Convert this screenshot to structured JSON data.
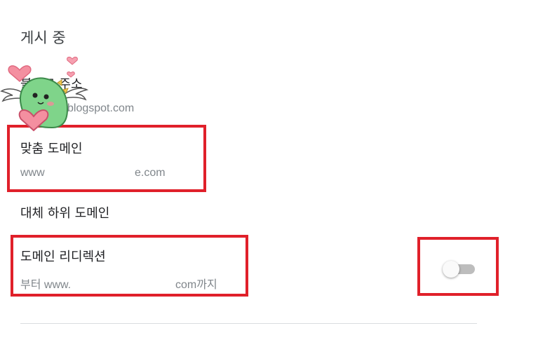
{
  "section": {
    "title": "게시 중"
  },
  "blog_address": {
    "title": "블로그 주소",
    "value_suffix": "blogspot.com"
  },
  "custom_domain": {
    "title": "맞춤 도메인",
    "value_prefix": "www",
    "value_suffix": "e.com"
  },
  "alt_subdomain": {
    "title": "대체 하위 도메인"
  },
  "domain_redirect": {
    "title": "도메인 리디렉션",
    "value_prefix": "부터 www.",
    "value_suffix": "com까지",
    "toggle_state": "off"
  },
  "colors": {
    "annotation": "#e0202a",
    "toggle_track": "#bdbdbd",
    "text_secondary": "#80868b"
  },
  "sticker": {
    "icon": "green-mascot-with-heart-sticker"
  }
}
